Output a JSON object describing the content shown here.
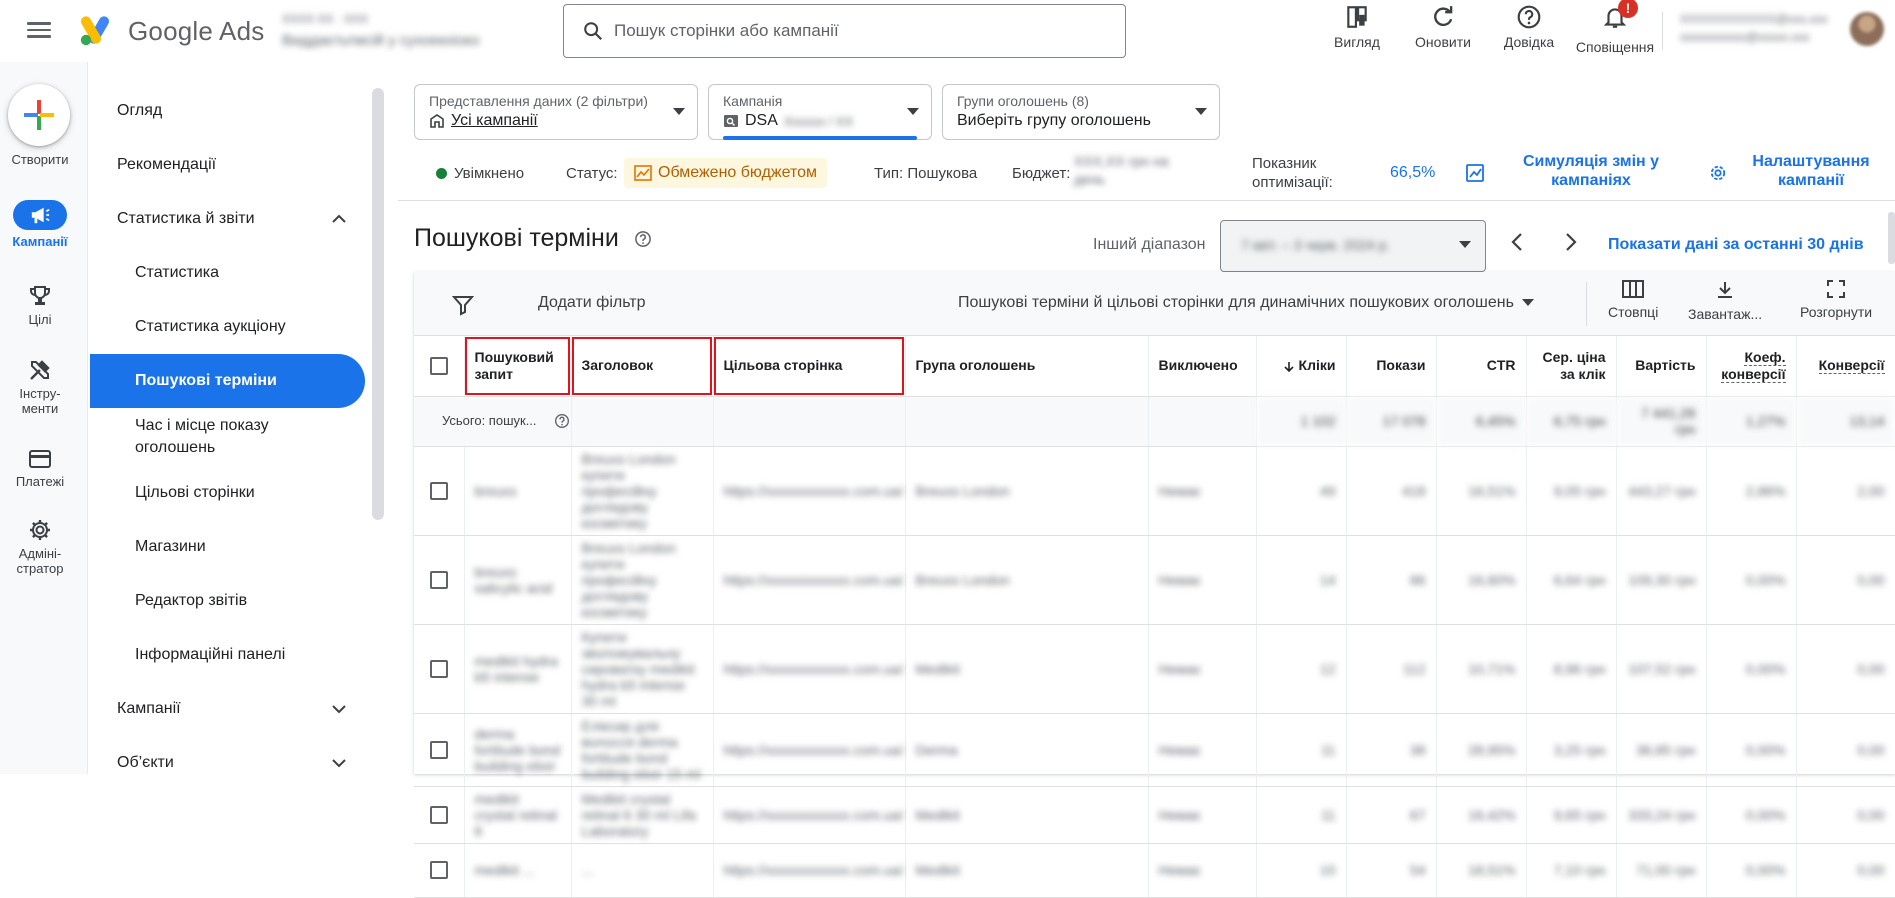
{
  "app": {
    "brand": "Google Ads",
    "account_line1": "ХХХХ ХХ · ХХХ",
    "account_line2": "Виддаєтьтмсій у сухоекхіоко",
    "search_placeholder": "Пошук сторінки або кампанії",
    "user_email_line1": "ХХХХХХХХХХХХ@ххх.ххх",
    "user_email_line2": "ххххххххххх@ххххх.ххх"
  },
  "header_actions": [
    {
      "icon": "view-icon",
      "label": "Вигляд"
    },
    {
      "icon": "refresh-icon",
      "label": "Оновити"
    },
    {
      "icon": "help-icon",
      "label": "Довідка"
    },
    {
      "icon": "bell-icon",
      "label": "Сповіщення",
      "badge": "!"
    }
  ],
  "rail": {
    "create_label": "Створити",
    "items": [
      {
        "icon": "megaphone-icon",
        "label": "Кампанії",
        "active": true
      },
      {
        "icon": "trophy-icon",
        "label": "Цілі"
      },
      {
        "icon": "tools-icon",
        "label": "Інстру-\nменти"
      },
      {
        "icon": "card-icon",
        "label": "Платежі"
      },
      {
        "icon": "gear-icon",
        "label": "Адміні-\nстратор"
      }
    ]
  },
  "sidenav": {
    "items": [
      {
        "label": "Огляд",
        "level": "top"
      },
      {
        "label": "Рекомендації",
        "level": "top"
      },
      {
        "label": "Статистика й звіти",
        "level": "top",
        "chevron": "up"
      },
      {
        "label": "Статистика",
        "level": "sub"
      },
      {
        "label": "Статистика аукціону",
        "level": "sub"
      },
      {
        "label": "Пошукові терміни",
        "level": "sub",
        "active": true
      },
      {
        "label": "Час і місце показу оголошень",
        "level": "sub"
      },
      {
        "label": "Цільові сторінки",
        "level": "sub"
      },
      {
        "label": "Магазини",
        "level": "sub"
      },
      {
        "label": "Редактор звітів",
        "level": "sub"
      },
      {
        "label": "Інформаційні панелі",
        "level": "sub"
      },
      {
        "label": "Кампанії",
        "level": "top",
        "chevron": "down"
      },
      {
        "label": "Об’єкти",
        "level": "top",
        "chevron": "down"
      }
    ]
  },
  "selectors": {
    "view": {
      "title": "Представлення даних (2 фільтри)",
      "value": "Усі кампанії"
    },
    "campaign": {
      "title": "Кампанія",
      "value": "DSA",
      "value_blur": "Хххххх / ХХ"
    },
    "adgroup": {
      "title": "Групи оголошень (8)",
      "value": "Виберіть групу оголошень"
    }
  },
  "status": {
    "enabled": "Увімкнено",
    "status_label": "Статус:",
    "status_value": "Обмежено бюджетом",
    "type": "Тип: Пошукова",
    "budget_label": "Бюджет:",
    "budget_value_line1": "ХХХ,ХХ грн на",
    "budget_value_line2": "день",
    "optim_label": "Показник оптимізації:",
    "optim_value": "66,5%",
    "simulate": "Симуляція змін у кампаніях",
    "settings": "Налаштування кампанії"
  },
  "title_row": {
    "title": "Пошукові терміни",
    "range_label": "Інший діапазон",
    "range_value": "7 квіт. – 3 черв. 2024 р.",
    "last30": "Показати дані за останні 30 днів"
  },
  "toolbar": {
    "add_filter": "Додати фільтр",
    "segment": "Пошукові терміни й цільові сторінки для динамічних пошукових оголошень",
    "columns": "Стовпці",
    "download": "Завантаж...",
    "expand": "Розгорнути"
  },
  "table": {
    "headers": [
      "Пошуковий запит",
      "Заголовок",
      "Цільова сторінка",
      "Група оголошень",
      "Виключено",
      "Кліки",
      "Покази",
      "CTR",
      "Сер. ціна за клік",
      "Вартість",
      "Коеф. конверсії",
      "Конверсії"
    ],
    "total": {
      "label": "Усього: пошук...",
      "clicks": "1 102",
      "impr": "17 078",
      "ctr": "6,45%",
      "cpc": "6,75 грн",
      "cost": "7 441,26 грн",
      "conv_rate": "1,27%",
      "conv": "13,14"
    },
    "rows": [
      {
        "query": "breuxs",
        "headline": "Breuxs London купити професійну доглядову косметику",
        "page": "https://xxxxxxxxxxxx.com.ua/...",
        "adgroup": "Breuxs London",
        "excluded": "Немає",
        "clicks": "49",
        "impr": "418",
        "ctr": "16,51%",
        "cpc": "9,05 грн",
        "cost": "443,27 грн",
        "conv_rate": "2,86%",
        "conv": "2,00"
      },
      {
        "query": "breuxs salicylic acid",
        "headline": "Breuxs London купити професійну доглядову косметику",
        "page": "https://xxxxxxxxxxxx.com.ua/...",
        "adgroup": "Breuxs London",
        "excluded": "Немає",
        "clicks": "14",
        "impr": "86",
        "ctr": "16,60%",
        "cpc": "6,64 грн",
        "cost": "109,30 грн",
        "conv_rate": "0,00%",
        "conv": "0,00"
      },
      {
        "query": "medikit hydra b5 intense",
        "headline": "Купити зволожувальну сироватку medikit hydra b5 intense 30 ml",
        "page": "https://xxxxxxxxxxxx.com.ua/...",
        "adgroup": "Medikit",
        "excluded": "Немає",
        "clicks": "12",
        "impr": "112",
        "ctr": "10,71%",
        "cpc": "8,96 грн",
        "cost": "107,52 грн",
        "conv_rate": "0,00%",
        "conv": "0,00"
      },
      {
        "query": "derma fortitude bond building elixir",
        "headline": "Еліксир для волосся derma fortitude bond building elixir 15 ml",
        "page": "https://xxxxxxxxxxxx.com.ua/...",
        "adgroup": "Derma",
        "excluded": "Немає",
        "clicks": "11",
        "impr": "38",
        "ctr": "28,95%",
        "cpc": "3,25 грн",
        "cost": "36,85 грн",
        "conv_rate": "0,00%",
        "conv": "0,00"
      },
      {
        "query": "medikit crystal retinal 6",
        "headline": "Medikit crystal retinal 6 30 ml Lifa Laboratory",
        "page": "https://xxxxxxxxxxxx.com.ua/...",
        "adgroup": "Medikit",
        "excluded": "Немає",
        "clicks": "11",
        "impr": "67",
        "ctr": "16,42%",
        "cpc": "9,65 грн",
        "cost": "333,24 грн",
        "conv_rate": "0,00%",
        "conv": "0,00"
      },
      {
        "query": "medikit ...",
        "headline": "...",
        "page": "https://xxxxxxxxxxxx.com.ua/...",
        "adgroup": "Medikit",
        "excluded": "Немає",
        "clicks": "10",
        "impr": "54",
        "ctr": "18,51%",
        "cpc": "7,10 грн",
        "cost": "71,00 грн",
        "conv_rate": "0,00%",
        "conv": "0,00"
      }
    ]
  },
  "colors": {
    "accent": "#1a73e8",
    "highlight_box": "#e0141e",
    "enabled": "#188038",
    "warn_bg": "#fef7e0",
    "warn_text": "#b06000"
  }
}
